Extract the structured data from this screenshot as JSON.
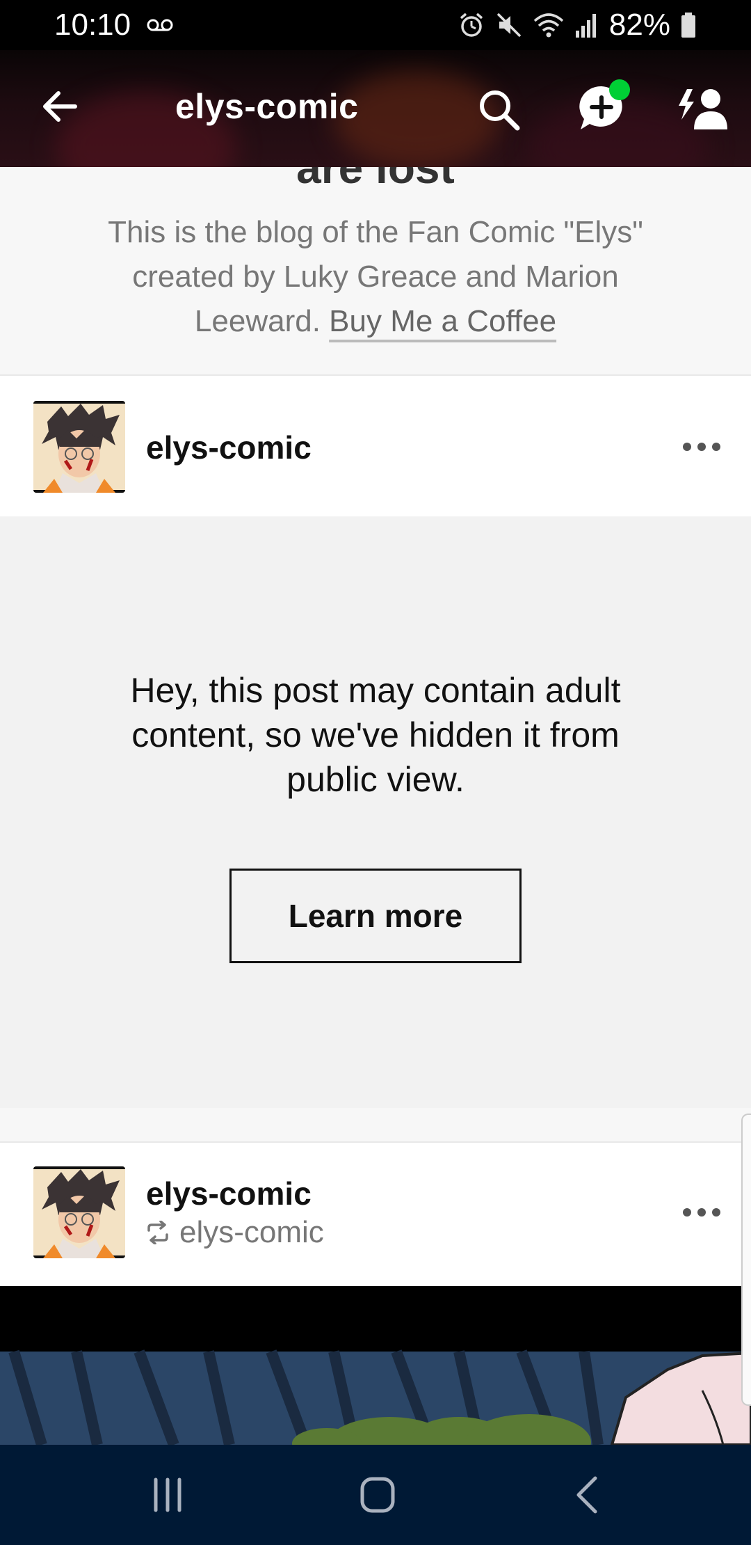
{
  "status_bar": {
    "time": "10:10",
    "battery": "82%"
  },
  "header": {
    "title": "elys-comic"
  },
  "blog": {
    "cut_title": "are lost",
    "description": "This is the blog of the Fan Comic \"Elys\" created by Luky Greace and Marion Leeward.",
    "link_label": "Buy Me a Coffee"
  },
  "posts": [
    {
      "author": "elys-comic",
      "reblogged_from": ""
    },
    {
      "author": "elys-comic",
      "reblogged_from": "elys-comic"
    }
  ],
  "hidden_post": {
    "message": "Hey, this post may contain adult content, so we've hidden it from public view.",
    "button_label": "Learn more"
  },
  "colors": {
    "notification_dot": "#00cf35",
    "nav_bar": "#001935",
    "hidden_bg": "#f2f2f2"
  }
}
